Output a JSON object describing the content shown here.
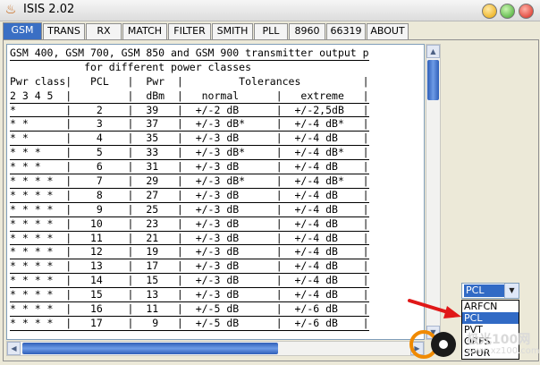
{
  "window": {
    "title": "ISIS 2.02",
    "icon": "flame-icon"
  },
  "tabs": [
    {
      "label": "GSM",
      "active": true
    },
    {
      "label": "TRANS"
    },
    {
      "label": "RX"
    },
    {
      "label": "MATCH"
    },
    {
      "label": "FILTER"
    },
    {
      "label": "SMITH"
    },
    {
      "label": "PLL"
    },
    {
      "label": "8960"
    },
    {
      "label": "66319"
    },
    {
      "label": "ABOUT"
    }
  ],
  "report": {
    "lines": [
      "GSM 400, GSM 700, GSM 850 and GSM 900 transmitter output p",
      "            for different power classes",
      "Pwr class|   PCL   |  Pwr  |         Tolerances          |",
      "2 3 4 5  |         |  dBm  |   normal      |   extreme   |",
      "*        |    2    |  39   |  +/-2 dB      |  +/-2,5dB   |",
      "* *      |    3    |  37   |  +/-3 dB*     |  +/-4 dB*   |",
      "* *      |    4    |  35   |  +/-3 dB      |  +/-4 dB    |",
      "* * *    |    5    |  33   |  +/-3 dB*     |  +/-4 dB*   |",
      "* * *    |    6    |  31   |  +/-3 dB      |  +/-4 dB    |",
      "* * * *  |    7    |  29   |  +/-3 dB*     |  +/-4 dB*   |",
      "* * * *  |    8    |  27   |  +/-3 dB      |  +/-4 dB    |",
      "* * * *  |    9    |  25   |  +/-3 dB      |  +/-4 dB    |",
      "* * * *  |   10    |  23   |  +/-3 dB      |  +/-4 dB    |",
      "* * * *  |   11    |  21   |  +/-3 dB      |  +/-4 dB    |",
      "* * * *  |   12    |  19   |  +/-3 dB      |  +/-4 dB    |",
      "* * * *  |   13    |  17   |  +/-3 dB      |  +/-4 dB    |",
      "* * * *  |   14    |  15   |  +/-3 dB      |  +/-4 dB    |",
      "* * * *  |   15    |  13   |  +/-3 dB      |  +/-4 dB    |",
      "* * * *  |   16    |  11   |  +/-5 dB      |  +/-6 dB    |",
      "* * * *  |   17    |   9   |  +/-5 dB      |  +/-6 dB    |"
    ],
    "underline_after": [
      0,
      3
    ]
  },
  "select": {
    "value": "PCL",
    "options": [
      "ARFCN",
      "PCL",
      "PVT",
      "ORFS",
      "SPUR"
    ],
    "selected_index": 1
  },
  "watermark": {
    "text": "极光100网",
    "url": "www.xz100.com"
  },
  "colors": {
    "accent": "#316ac5",
    "tab_active": "#3a6fc4",
    "arrow": "#e01818"
  }
}
